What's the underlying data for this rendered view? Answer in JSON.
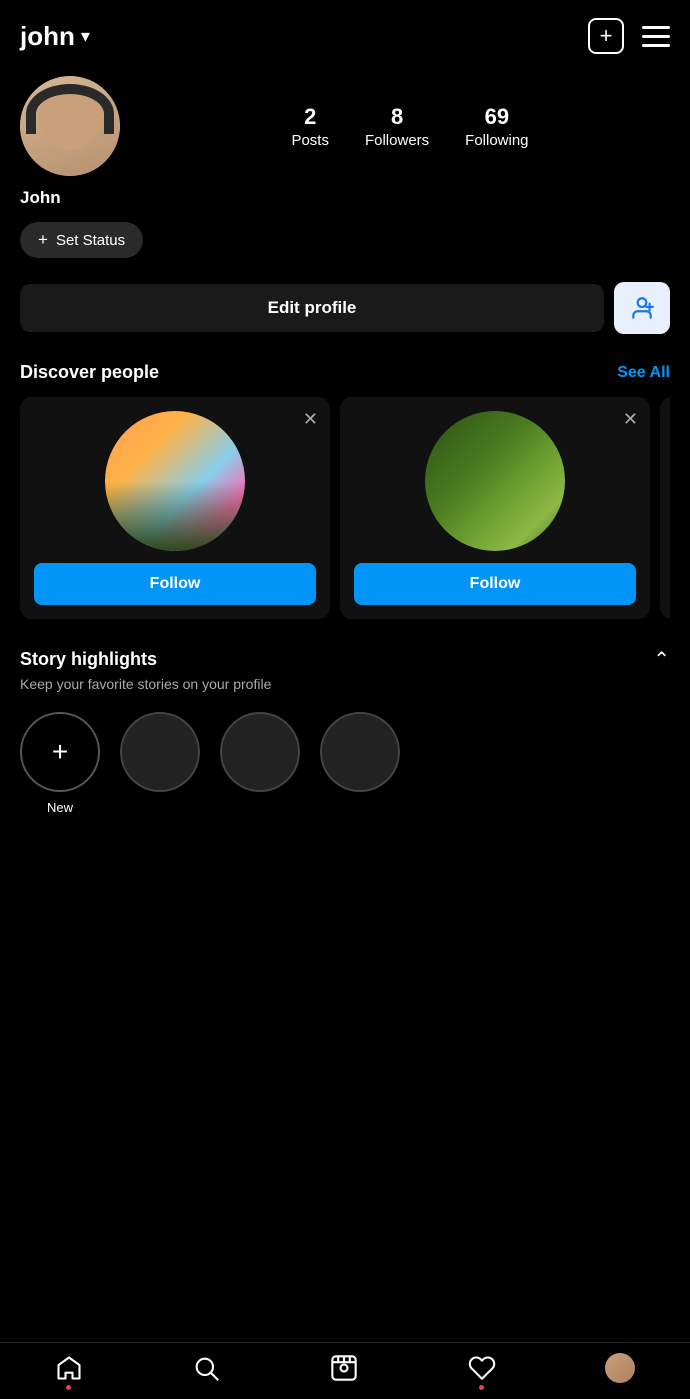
{
  "header": {
    "username": "john",
    "chevron": "▾",
    "add_icon_label": "+",
    "menu_label": "menu"
  },
  "profile": {
    "name": "John",
    "stats": {
      "posts_count": "2",
      "posts_label": "Posts",
      "followers_count": "8",
      "followers_label": "Followers",
      "following_count": "69",
      "following_label": "Following"
    },
    "set_status_label": "Set Status",
    "edit_profile_label": "Edit profile"
  },
  "discover": {
    "title": "Discover people",
    "see_all_label": "See All",
    "cards": [
      {
        "id": "card1",
        "follow_label": "Follow"
      },
      {
        "id": "card2",
        "follow_label": "Follow"
      }
    ]
  },
  "story": {
    "title": "Story highlights",
    "subtitle": "Keep your favorite stories on your profile",
    "new_label": "New"
  },
  "bottom_nav": {
    "home_label": "home",
    "search_label": "search",
    "reels_label": "reels",
    "activity_label": "activity",
    "profile_label": "profile"
  }
}
